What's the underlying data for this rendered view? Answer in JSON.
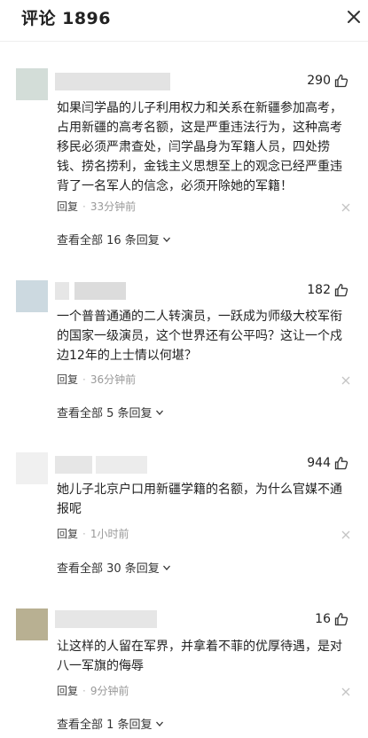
{
  "header": {
    "title": "评论 1896"
  },
  "comments": [
    {
      "likes": "290",
      "text": "如果闫学晶的儿子利用权力和关系在新疆参加高考，占用新疆的高考名额，这是严重违法行为，这种高考移民必须严肃查处，闫学晶身为军籍人员，四处捞钱、捞名捞利，金钱主义思想至上的观念已经严重违背了一名军人的信念，必须开除她的军籍！",
      "reply_label": "回复",
      "time": "33分钟前",
      "view_all": "查看全部 16 条回复"
    },
    {
      "likes": "182",
      "text": "一个普普通通的二人转演员，一跃成为师级大校军衔的国家一级演员，这个世界还有公平吗？这让一个戍边12年的上士情以何堪？",
      "reply_label": "回复",
      "time": "36分钟前",
      "view_all": "查看全部 5 条回复"
    },
    {
      "likes": "944",
      "text": "她儿子北京户口用新疆学籍的名额，为什么官媒不通报呢",
      "reply_label": "回复",
      "time": "1小时前",
      "view_all": "查看全部 30 条回复"
    },
    {
      "likes": "16",
      "text": "让这样的人留在军界，并拿着不菲的优厚待遇，是对八一军旗的侮辱",
      "reply_label": "回复",
      "time": "9分钟前",
      "view_all": "查看全部 1 条回复"
    }
  ],
  "icons": {
    "close": "close-icon",
    "like": "thumbs-up-icon",
    "dismiss": "dismiss-x-icon",
    "expand": "chevron-down-icon"
  },
  "colors": {
    "avatar_1": "#d3ddd8",
    "avatar_2": "#ccd9e0",
    "avatar_3": "#f0f0f0",
    "avatar_4": "#b8b092",
    "name_blur": "#e3e3e3",
    "divider": "#eeeeee"
  }
}
